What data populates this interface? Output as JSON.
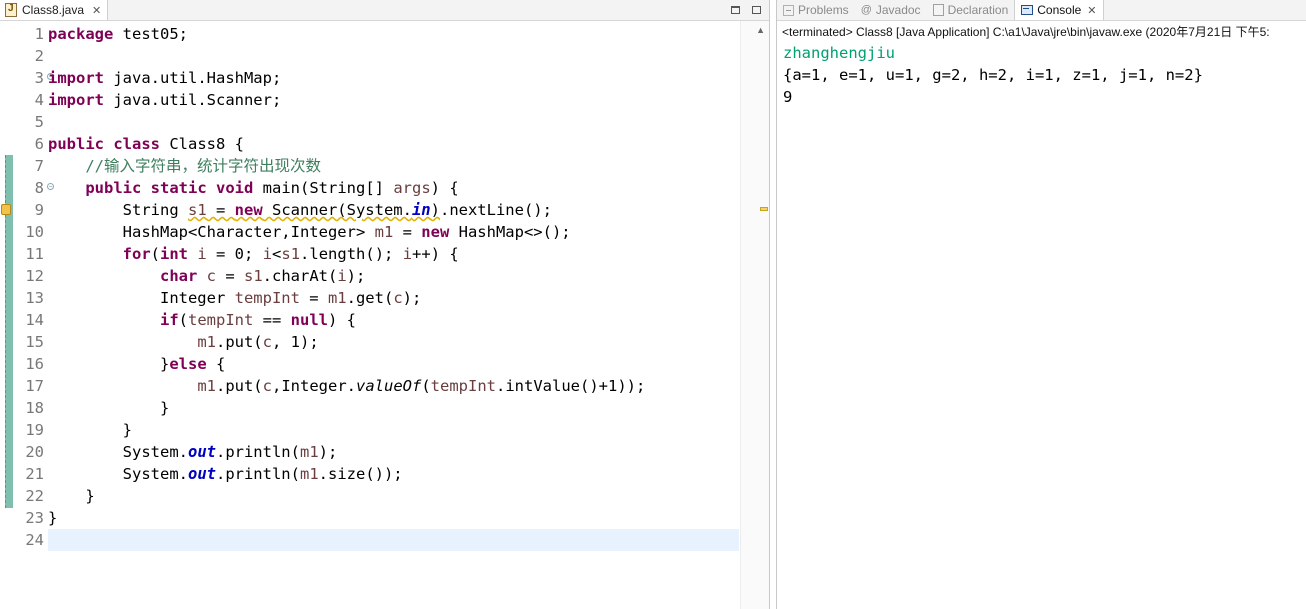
{
  "editor": {
    "tab_label": "Class8.java",
    "lines": [
      {
        "no": "1",
        "html": "<span class=\"kw\">package</span> test05;"
      },
      {
        "no": "2",
        "html": ""
      },
      {
        "no": "3",
        "html": "<span class=\"kw\">import</span> java.util.HashMap;"
      },
      {
        "no": "4",
        "html": "<span class=\"kw\">import</span> java.util.Scanner;"
      },
      {
        "no": "5",
        "html": ""
      },
      {
        "no": "6",
        "html": "<span class=\"kw\">public</span> <span class=\"kw\">class</span> Class8 {"
      },
      {
        "no": "7",
        "html": "    <span class=\"com\">//输入字符串，统计字符出现次数</span>"
      },
      {
        "no": "8",
        "html": "    <span class=\"kw\">public</span> <span class=\"kw\">static</span> <span class=\"kw\">void</span> main(String[] <span class=\"var\">args</span>) {"
      },
      {
        "no": "9",
        "html": "        String <span class=\"warnu\"><span class=\"var\">s1</span> = <span class=\"kw\">new</span> Scanner(System.<span class=\"fld\">in</span>)</span>.nextLine();"
      },
      {
        "no": "10",
        "html": "        HashMap&lt;Character,Integer&gt; <span class=\"var\">m1</span> = <span class=\"kw\">new</span> HashMap&lt;&gt;();"
      },
      {
        "no": "11",
        "html": "        <span class=\"kw\">for</span>(<span class=\"kw\">int</span> <span class=\"var\">i</span> = 0; <span class=\"var\">i</span>&lt;<span class=\"var\">s1</span>.length(); <span class=\"var\">i</span>++) {"
      },
      {
        "no": "12",
        "html": "            <span class=\"kw\">char</span> <span class=\"var\">c</span> = <span class=\"var\">s1</span>.charAt(<span class=\"var\">i</span>);"
      },
      {
        "no": "13",
        "html": "            Integer <span class=\"var\">tempInt</span> = <span class=\"var\">m1</span>.get(<span class=\"var\">c</span>);"
      },
      {
        "no": "14",
        "html": "            <span class=\"kw\">if</span>(<span class=\"var\">tempInt</span> == <span class=\"kw\">null</span>) {"
      },
      {
        "no": "15",
        "html": "                <span class=\"var\">m1</span>.put(<span class=\"var\">c</span>, 1);"
      },
      {
        "no": "16",
        "html": "            }<span class=\"kw\">else</span> {"
      },
      {
        "no": "17",
        "html": "                <span class=\"var\">m1</span>.put(<span class=\"var\">c</span>,Integer.<span class=\"st\">valueOf</span>(<span class=\"var\">tempInt</span>.intValue()+1));"
      },
      {
        "no": "18",
        "html": "            }"
      },
      {
        "no": "19",
        "html": "        }"
      },
      {
        "no": "20",
        "html": "        System.<span class=\"fld\">out</span>.println(<span class=\"var\">m1</span>);"
      },
      {
        "no": "21",
        "html": "        System.<span class=\"fld\">out</span>.println(<span class=\"var\">m1</span>.size());"
      },
      {
        "no": "22",
        "html": "    }"
      },
      {
        "no": "23",
        "html": "}"
      },
      {
        "no": "24",
        "html": ""
      }
    ],
    "folds": [
      "3",
      "8"
    ],
    "current_line": "24"
  },
  "console_view": {
    "tabs": [
      {
        "label": "Problems",
        "icon": "problems-icon"
      },
      {
        "label": "Javadoc",
        "icon": "at-icon"
      },
      {
        "label": "Declaration",
        "icon": "declaration-icon"
      },
      {
        "label": "Console",
        "icon": "console-icon",
        "active": true
      }
    ],
    "status": "<terminated> Class8 [Java Application] C:\\a1\\Java\\jre\\bin\\javaw.exe (2020年7月21日 下午5:",
    "input_line": "zhanghengjiu",
    "output_lines": [
      "{a=1, e=1, u=1, g=2, h=2, i=1, z=1, j=1, n=2}",
      "9"
    ],
    "input_color": "#00a070"
  }
}
